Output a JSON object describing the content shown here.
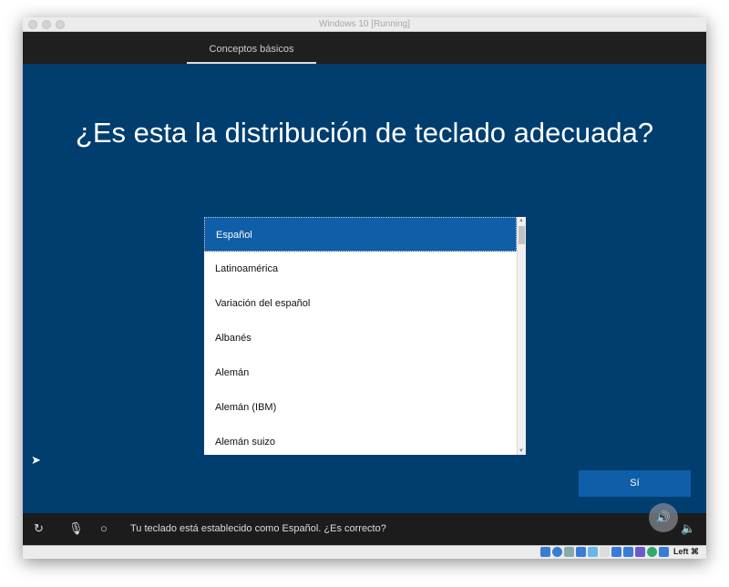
{
  "window": {
    "title": "Windows 10 [Running]"
  },
  "header": {
    "tab": "Conceptos básicos"
  },
  "main": {
    "question": "¿Es esta la distribución de teclado adecuada?",
    "layouts": [
      "Español",
      "Latinoamérica",
      "Variación del español",
      "Albanés",
      "Alemán",
      "Alemán (IBM)",
      "Alemán suizo"
    ],
    "selected": "Español",
    "confirm_label": "Sí"
  },
  "bottom_bar": {
    "message": "Tu teclado está establecido como Español. ¿Es correcto?"
  },
  "status_bar": {
    "host_key": "Left ⌘"
  },
  "colors": {
    "background": "#003e6f",
    "accent": "#0f5ea8"
  }
}
